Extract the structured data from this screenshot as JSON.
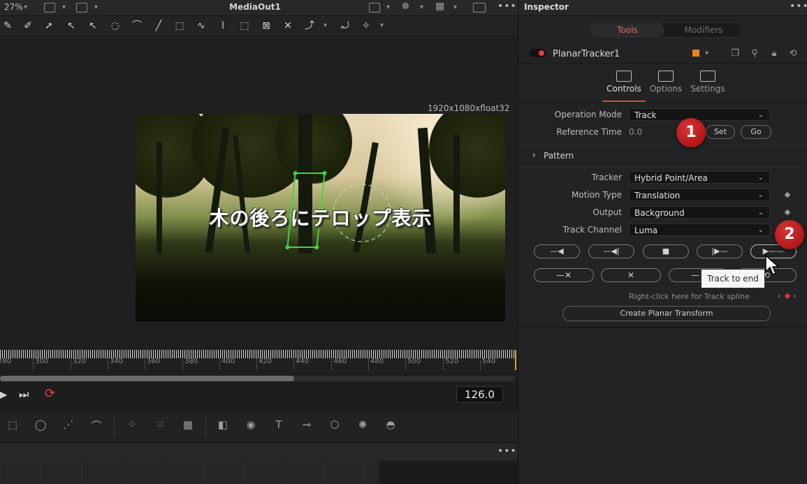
{
  "viewer": {
    "zoom": "27%",
    "title": "MediaOut1",
    "resolution": "1920x1080xfloat32",
    "caption": "木の後ろにテロップ表示",
    "frame": "126.0",
    "ruler_labels": [
      "280",
      "300",
      "320",
      "340",
      "360",
      "380",
      "400",
      "420",
      "440",
      "460",
      "480",
      "500",
      "520",
      "540"
    ],
    "scroll_fraction": 0.57
  },
  "inspector": {
    "title": "Inspector",
    "seg_tools": "Tools",
    "seg_modifiers": "Modifiers",
    "node_name": "PlanarTracker1",
    "node_color": "#e8841a",
    "tabs": [
      {
        "label": "Controls",
        "icon": "controls-icon"
      },
      {
        "label": "Options",
        "icon": "options-icon"
      },
      {
        "label": "Settings",
        "icon": "settings-icon"
      }
    ],
    "operation_mode_label": "Operation Mode",
    "operation_mode_value": "Track",
    "reference_time_label": "Reference Time",
    "reference_time_value": "0.0",
    "set_label": "Set",
    "go_label": "Go",
    "pattern_label": "Pattern",
    "tracker_label": "Tracker",
    "tracker_value": "Hybrid Point/Area",
    "motion_type_label": "Motion Type",
    "motion_type_value": "Translation",
    "output_label": "Output",
    "output_value": "Background",
    "track_channel_label": "Track Channel",
    "track_channel_value": "Luma",
    "spline_hint": "Right-click here for Track spline",
    "create_button": "Create Planar Transform"
  },
  "annotations": {
    "callout1": "1",
    "callout2": "2",
    "tooltip": "Track to end"
  }
}
